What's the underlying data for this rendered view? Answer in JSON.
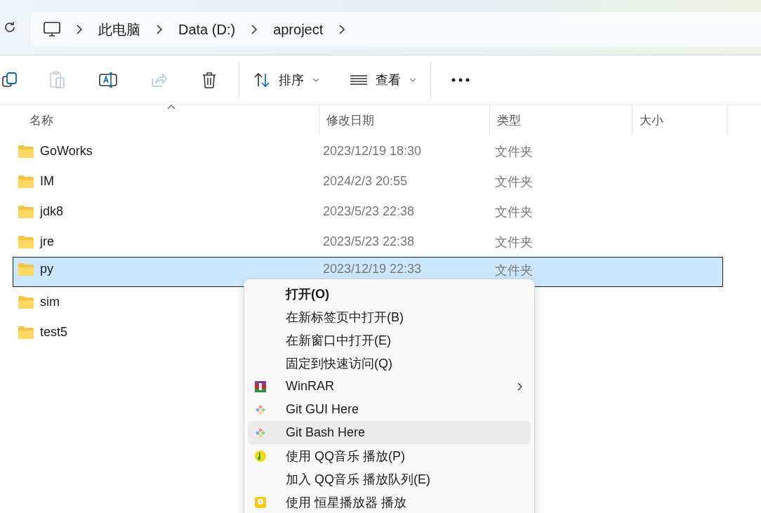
{
  "breadcrumb": [
    "此电脑",
    "Data (D:)",
    "aproject"
  ],
  "toolbar": {
    "actions": [
      {
        "kind": "copy",
        "disabled": false
      },
      {
        "kind": "paste",
        "disabled": true
      },
      {
        "kind": "rename",
        "disabled": false
      },
      {
        "kind": "share",
        "disabled": true
      },
      {
        "kind": "delete",
        "disabled": false
      }
    ],
    "sort": "排序",
    "view": "查看"
  },
  "table": {
    "columns": [
      "名称",
      "修改日期",
      "类型",
      "大小"
    ],
    "rows": [
      {
        "name": "GoWorks",
        "date": "2023/12/19 18:30",
        "type": "文件夹",
        "selected": false
      },
      {
        "name": "IM",
        "date": "2024/2/3 20:55",
        "type": "文件夹",
        "selected": false
      },
      {
        "name": "jdk8",
        "date": "2023/5/23 22:38",
        "type": "文件夹",
        "selected": false
      },
      {
        "name": "jre",
        "date": "2023/5/23 22:38",
        "type": "文件夹",
        "selected": false
      },
      {
        "name": "py",
        "date": "2023/12/19 22:33",
        "type": "文件夹",
        "selected": true
      },
      {
        "name": "sim",
        "selected": false
      },
      {
        "name": "test5",
        "selected": false
      }
    ]
  },
  "context_menu": {
    "items": [
      {
        "label": "打开(O)",
        "kind": "plain",
        "bold": true,
        "submenu": false,
        "selected": false
      },
      {
        "label": "在新标签页中打开(B)",
        "kind": "plain",
        "bold": false,
        "submenu": false,
        "selected": false
      },
      {
        "label": "在新窗口中打开(E)",
        "kind": "plain",
        "bold": false,
        "submenu": false,
        "selected": false
      },
      {
        "label": "固定到快速访问(Q)",
        "kind": "plain",
        "bold": false,
        "submenu": false,
        "selected": false
      },
      {
        "label": "WinRAR",
        "kind": "archive",
        "bold": false,
        "submenu": true,
        "selected": false
      },
      {
        "label": "Git GUI Here",
        "kind": "git",
        "bold": false,
        "submenu": false,
        "selected": false
      },
      {
        "label": "Git Bash Here",
        "kind": "git",
        "bold": false,
        "submenu": false,
        "selected": true
      },
      {
        "label": "使用 QQ音乐 播放(P)",
        "kind": "music",
        "bold": false,
        "submenu": false,
        "selected": false
      },
      {
        "label": "加入 QQ音乐 播放队列(E)",
        "kind": "plain",
        "bold": false,
        "submenu": false,
        "selected": false
      },
      {
        "label": "使用 恒星播放器 播放",
        "kind": "player",
        "bold": false,
        "submenu": false,
        "selected": false
      }
    ]
  }
}
